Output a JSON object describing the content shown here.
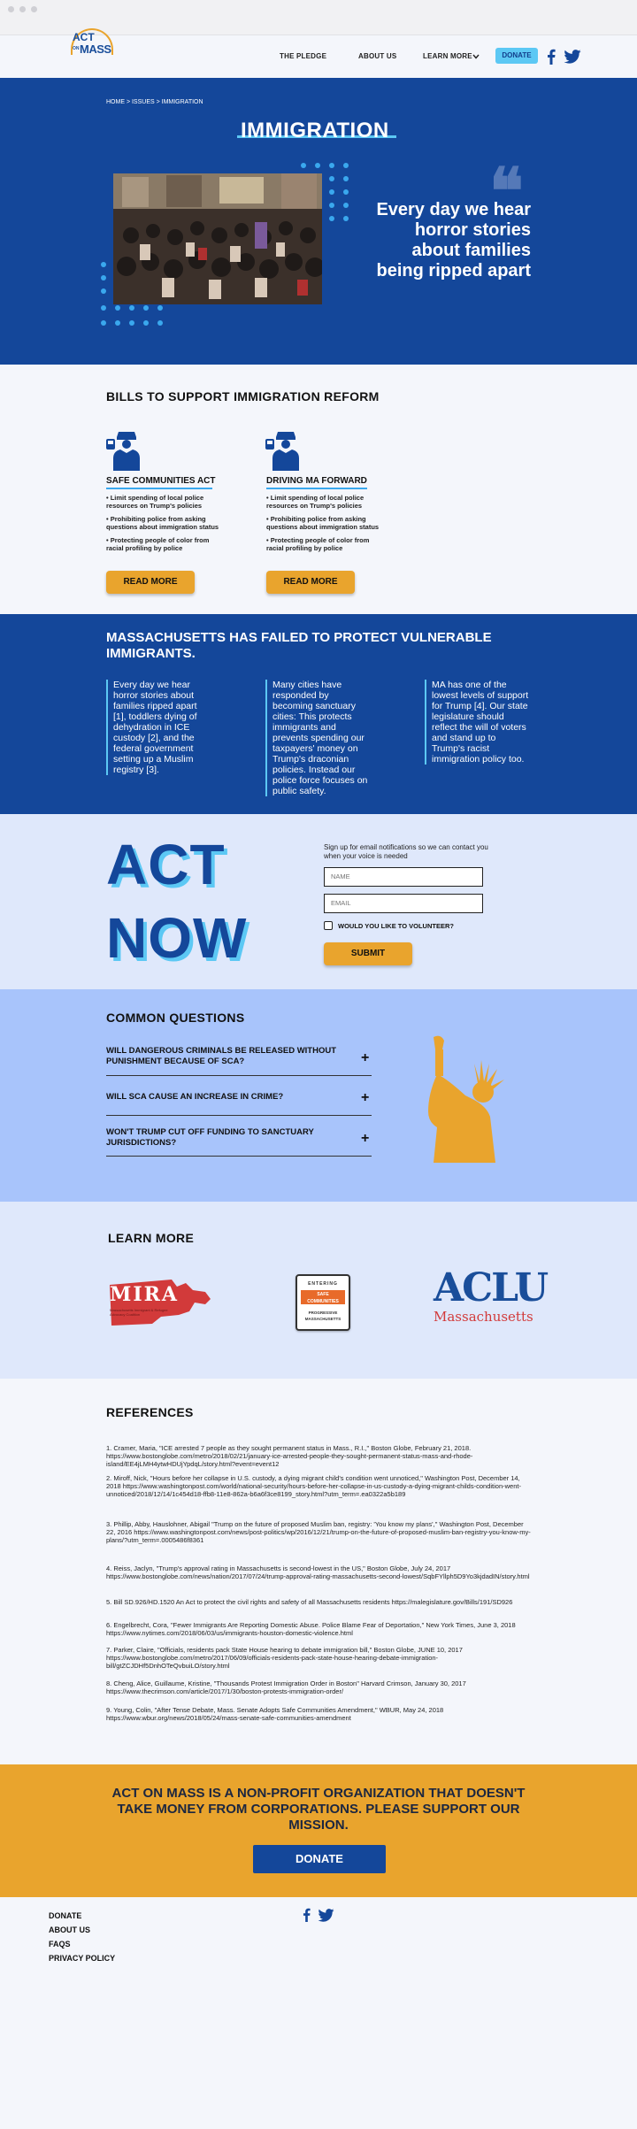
{
  "header": {
    "logo_top": "ACT",
    "logo_on": "ON",
    "logo_mass": "MASS",
    "nav": [
      "THE PLEDGE",
      "ABOUT US",
      "LEARN MORE"
    ],
    "donate": "DONATE",
    "social_icons": [
      "facebook-icon",
      "twitter-icon"
    ]
  },
  "hero": {
    "breadcrumb": "HOME > ISSUES > IMMIGRATION",
    "title": "IMMIGRATION",
    "quote": "Every day we hear horror stories about families being ripped apart",
    "quote_mark": "❝"
  },
  "bills": {
    "heading": "BILLS TO SUPPORT IMMIGRATION REFORM",
    "items": [
      {
        "title": "SAFE COMMUNITIES ACT",
        "points": [
          "• Limit spending of local police resources on Trump's policies",
          "• Prohibiting police from asking questions about immigration status",
          "• Protecting people of color from racial profiling by police"
        ],
        "button": "READ MORE"
      },
      {
        "title": "DRIVING MA FORWARD",
        "points": [
          "• Limit spending of local police resources on Trump's policies",
          "• Prohibiting police from asking questions about immigration status",
          "• Protecting people of color from racial profiling by police"
        ],
        "button": "READ MORE"
      }
    ]
  },
  "failed": {
    "heading": "MASSACHUSETTS HAS FAILED TO PROTECT VULNERABLE IMMIGRANTS.",
    "columns": [
      "Every day we hear horror stories about families ripped apart [1], toddlers dying of dehydration in ICE custody [2], and the federal government setting up a Muslim registry [3].",
      "Many cities have responded by becoming sanctuary cities: This protects immigrants and prevents spending our taxpayers' money on Trump's draconian policies. Instead our police force focuses on public safety.",
      "MA has one of the lowest levels of support for Trump [4]. Our state legislature should reflect the will of voters and stand up to Trump's racist immigration policy too."
    ]
  },
  "act": {
    "word1": "ACT",
    "word2": "NOW",
    "signup_text": "Sign up for email notifications so we can contact you when your voice is needed",
    "name_placeholder": "NAME",
    "email_placeholder": "EMAIL",
    "volunteer_label": "WOULD YOU LIKE TO VOLUNTEER?",
    "submit": "SUBMIT"
  },
  "questions": {
    "heading": "COMMON QUESTIONS",
    "items": [
      "WILL DANGEROUS CRIMINALS BE RELEASED WITHOUT PUNISHMENT BECAUSE OF SCA?",
      "WILL SCA CAUSE AN INCREASE IN CRIME?",
      "WON'T TRUMP CUT OFF FUNDING TO SANCTUARY JURISDICTIONS?"
    ],
    "expand_symbol": "+"
  },
  "learn": {
    "heading": "LEARN MORE",
    "mira": {
      "name": "MIRA",
      "subtitle": "Massachusetts Immigrant & Refugee Advocacy Coalition"
    },
    "safe": {
      "top": "ENTERING",
      "middle": "SAFE COMMUNITIES",
      "bottom": "PROGRESSIVE MASSACHUSETTS"
    },
    "aclu": {
      "name": "ACLU",
      "state": "Massachusetts"
    }
  },
  "references": {
    "heading": "REFERENCES",
    "items": [
      "1. Cramer, Maria, \"ICE arrested 7 people as they sought permanent status in Mass., R.I.,\" Boston Globe, February 21, 2018. https://www.bostonglobe.com/metro/2018/02/21/january-ice-arrested-people-they-sought-permanent-status-mass-and-rhode-island/EE4jLMH4ytwHDUjYpdqL/story.html?event=event12",
      "2. Miroff, Nick, \"Hours before her collapse in U.S. custody, a dying migrant child's condition went unnoticed,\" Washington Post, December 14, 2018 https://www.washingtonpost.com/world/national-security/hours-before-her-collapse-in-us-custody-a-dying-migrant-childs-condition-went-unnoticed/2018/12/14/1c454d18-ffb8-11e8-862a-b6a6f3ce8199_story.html?utm_term=.ea0322a5b189",
      "3. Phillip, Abby, Hauslohner, Abigail \"Trump on the future of proposed Muslim ban, registry: 'You know my plans',\" Washington Post, December 22, 2016 https://www.washingtonpost.com/news/post-politics/wp/2016/12/21/trump-on-the-future-of-proposed-muslim-ban-registry-you-know-my-plans/?utm_term=.0005486f8361",
      "4. Reiss, Jaclyn, \"Trump's approval rating in Massachusetts is second-lowest in the US,\" Boston Globe, July 24, 2017 https://www.bostonglobe.com/news/nation/2017/07/24/trump-approval-rating-massachusetts-second-lowest/SqbFYllph5D9Yo3kjdadIN/story.html",
      "5. Bill SD.926/HD.1520 An Act to protect the civil rights and safety of all Massachusetts residents https://malegislature.gov/Bills/191/SD926",
      "6. Engelbrecht, Cora, \"Fewer Immigrants Are Reporting Domestic Abuse. Police Blame Fear of Deportation,\" New York Times, June 3, 2018 https://www.nytimes.com/2018/06/03/us/immigrants-houston-domestic-violence.html",
      "7. Parker, Claire, \"Officials, residents pack State House hearing to debate immigration bill,\" Boston Globe, JUNE 10, 2017 https://www.bostonglobe.com/metro/2017/06/09/officials-residents-pack-state-house-hearing-debate-immigration-bill/gtZCJDHf5DnhOTeQvbuiLO/story.html",
      "8. Cheng, Alice, Guillaume, Kristine, \"Thousands Protest Immigration Order in Boston\" Harvard Crimson, January 30, 2017 https://www.thecrimson.com/article/2017/1/30/boston-protests-immigration-order/",
      "9. Young, Colin, \"After Tense Debate, Mass. Senate Adopts Safe Communities Amendment,\" WBUR, May 24, 2018 https://www.wbur.org/news/2018/05/24/mass-senate-safe-communities-amendment"
    ]
  },
  "cta": {
    "text": "ACT ON MASS IS A NON-PROFIT ORGANIZATION THAT DOESN'T TAKE MONEY FROM CORPORATIONS. PLEASE SUPPORT OUR MISSION.",
    "button": "DONATE"
  },
  "footer": {
    "links": [
      "DONATE",
      "ABOUT US",
      "FAQS",
      "PRIVACY POLICY"
    ]
  },
  "colors": {
    "brand_blue": "#14479a",
    "accent_yellow": "#e9a42d",
    "accent_cyan": "#5cc8f4"
  }
}
